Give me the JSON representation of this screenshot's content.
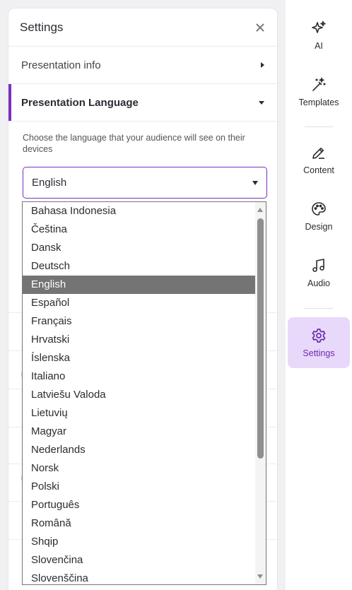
{
  "panel": {
    "title": "Settings",
    "sections": [
      {
        "label": "Presentation info",
        "expanded": false
      },
      {
        "label": "Presentation Language",
        "expanded": true
      }
    ]
  },
  "language": {
    "description": "Choose the language that your audience will see on their devices",
    "selected": "English",
    "options": [
      "Bahasa Indonesia",
      "Čeština",
      "Dansk",
      "Deutsch",
      "English",
      "Español",
      "Français",
      "Hrvatski",
      "Íslenska",
      "Italiano",
      "Latviešu Valoda",
      "Lietuvių",
      "Magyar",
      "Nederlands",
      "Norsk",
      "Polski",
      "Português",
      "Română",
      "Shqip",
      "Slovenčina",
      "Slovenščina"
    ]
  },
  "rail": {
    "items": [
      {
        "label": "AI",
        "icon": "sparkles-icon",
        "active": false
      },
      {
        "label": "Templates",
        "icon": "magic-wand-icon",
        "active": false
      },
      {
        "label": "Content",
        "icon": "pencil-icon",
        "active": false
      },
      {
        "label": "Design",
        "icon": "palette-icon",
        "active": false
      },
      {
        "label": "Audio",
        "icon": "music-note-icon",
        "active": false
      },
      {
        "label": "Settings",
        "icon": "gear-icon",
        "active": true
      }
    ]
  },
  "colors": {
    "accent": "#7b2fbf",
    "active_bg": "#e8d9fb",
    "selected_option": "#747474"
  }
}
